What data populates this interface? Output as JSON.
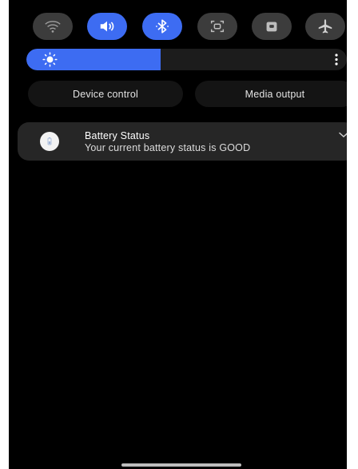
{
  "quick_settings": [
    {
      "name": "wifi",
      "icon": "wifi-icon",
      "active": false
    },
    {
      "name": "sound",
      "icon": "volume-icon",
      "active": true
    },
    {
      "name": "bluetooth",
      "icon": "bluetooth-icon",
      "active": true
    },
    {
      "name": "screen-capture",
      "icon": "screenshot-icon",
      "active": false
    },
    {
      "name": "lock",
      "icon": "lock-icon",
      "active": false
    },
    {
      "name": "airplane-mode",
      "icon": "airplane-icon",
      "active": false
    }
  ],
  "brightness": {
    "level": 0.42,
    "icon": "sun-icon",
    "more_icon": "more-vertical-icon",
    "accent": "#3d6cf2"
  },
  "buttons": {
    "device_control": "Device control",
    "media_output": "Media output"
  },
  "notification": {
    "title": "Battery Status",
    "text": "Your current battery status is GOOD",
    "icon": "battery-app-icon",
    "expand_icon": "chevron-down-icon"
  },
  "colors": {
    "background": "#000000",
    "active_toggle": "#3d6cf2",
    "inactive_toggle": "#3c3c3c",
    "card": "#262626"
  }
}
